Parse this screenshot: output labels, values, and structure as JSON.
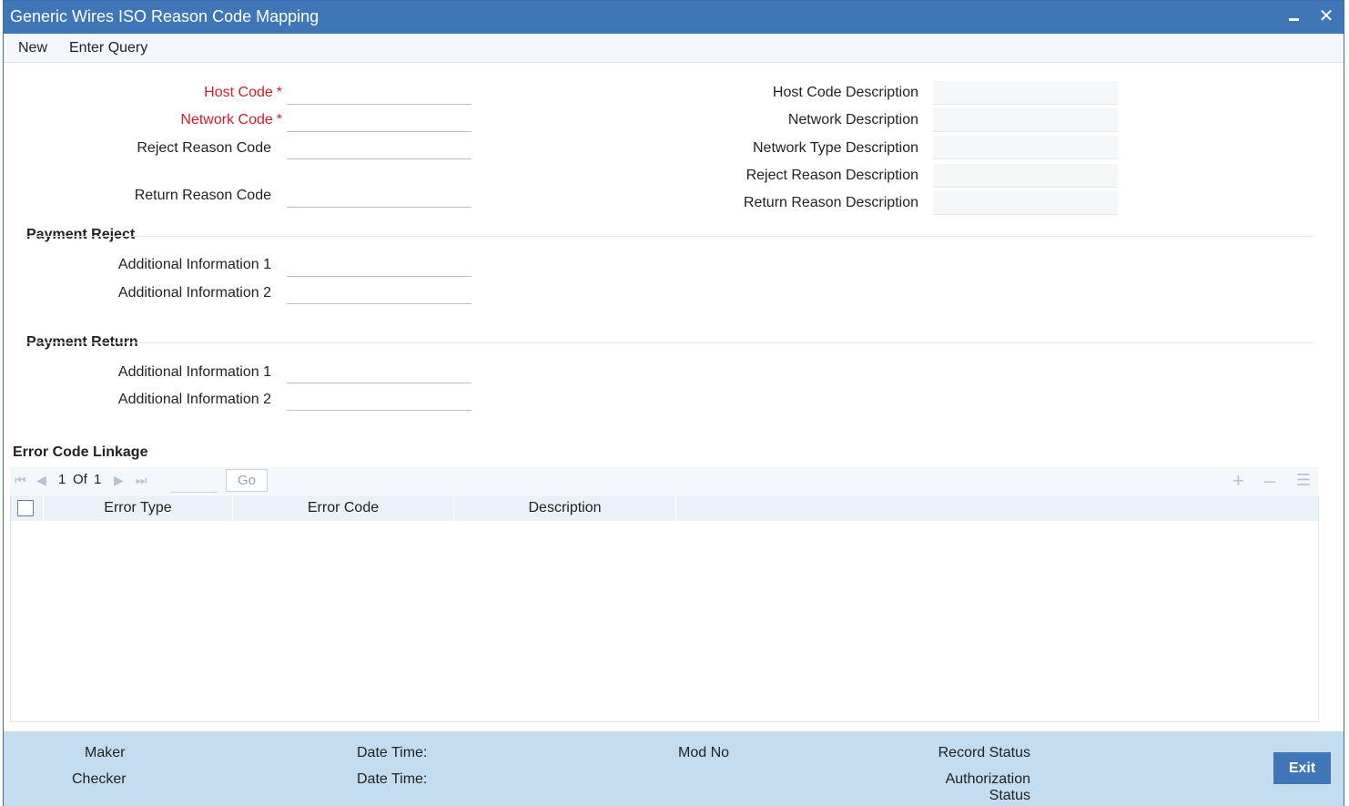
{
  "window": {
    "title": "Generic Wires ISO Reason Code Mapping"
  },
  "menu": {
    "new_label": "New",
    "enter_query_label": "Enter Query"
  },
  "form": {
    "host_code_label": "Host Code",
    "network_code_label": "Network Code",
    "required_marker": "*",
    "reject_reason_code_label": "Reject Reason Code",
    "return_reason_code_label": "Return Reason Code",
    "host_code_description_label": "Host Code Description",
    "network_description_label": "Network Description",
    "network_type_description_label": "Network Type Description",
    "reject_reason_description_label": "Reject Reason Description",
    "return_reason_description_label": "Return Reason Description"
  },
  "payment_reject": {
    "title": "Payment Reject",
    "additional_info_1_label": "Additional Information 1",
    "additional_info_2_label": "Additional Information 2"
  },
  "payment_return": {
    "title": "Payment Return",
    "additional_info_1_label": "Additional Information 1",
    "additional_info_2_label": "Additional Information 2"
  },
  "error_linkage": {
    "title": "Error Code Linkage",
    "pager": {
      "current_page": "1",
      "of_label": "Of",
      "total_pages": "1",
      "go_label": "Go"
    },
    "columns": [
      "Error Type",
      "Error Code",
      "Description"
    ]
  },
  "footer": {
    "maker_label": "Maker",
    "checker_label": "Checker",
    "date_time_label_1": "Date Time:",
    "date_time_label_2": "Date Time:",
    "mod_no_label": "Mod No",
    "record_status_label": "Record Status",
    "authorization_label": "Authorization",
    "status_label": "Status",
    "exit_label": "Exit"
  },
  "icons": {
    "first_page": "first-page-icon",
    "prev_page": "prev-page-icon",
    "next_page": "next-page-icon",
    "last_page": "last-page-icon",
    "add_row": "plus-icon",
    "delete_row": "minus-icon",
    "single_view": "list-icon",
    "minimize": "minimize-icon",
    "close": "close-icon"
  },
  "colors": {
    "title_bar": "#3e76b8",
    "required": "#d0202a",
    "footer": "#c3dcef"
  }
}
